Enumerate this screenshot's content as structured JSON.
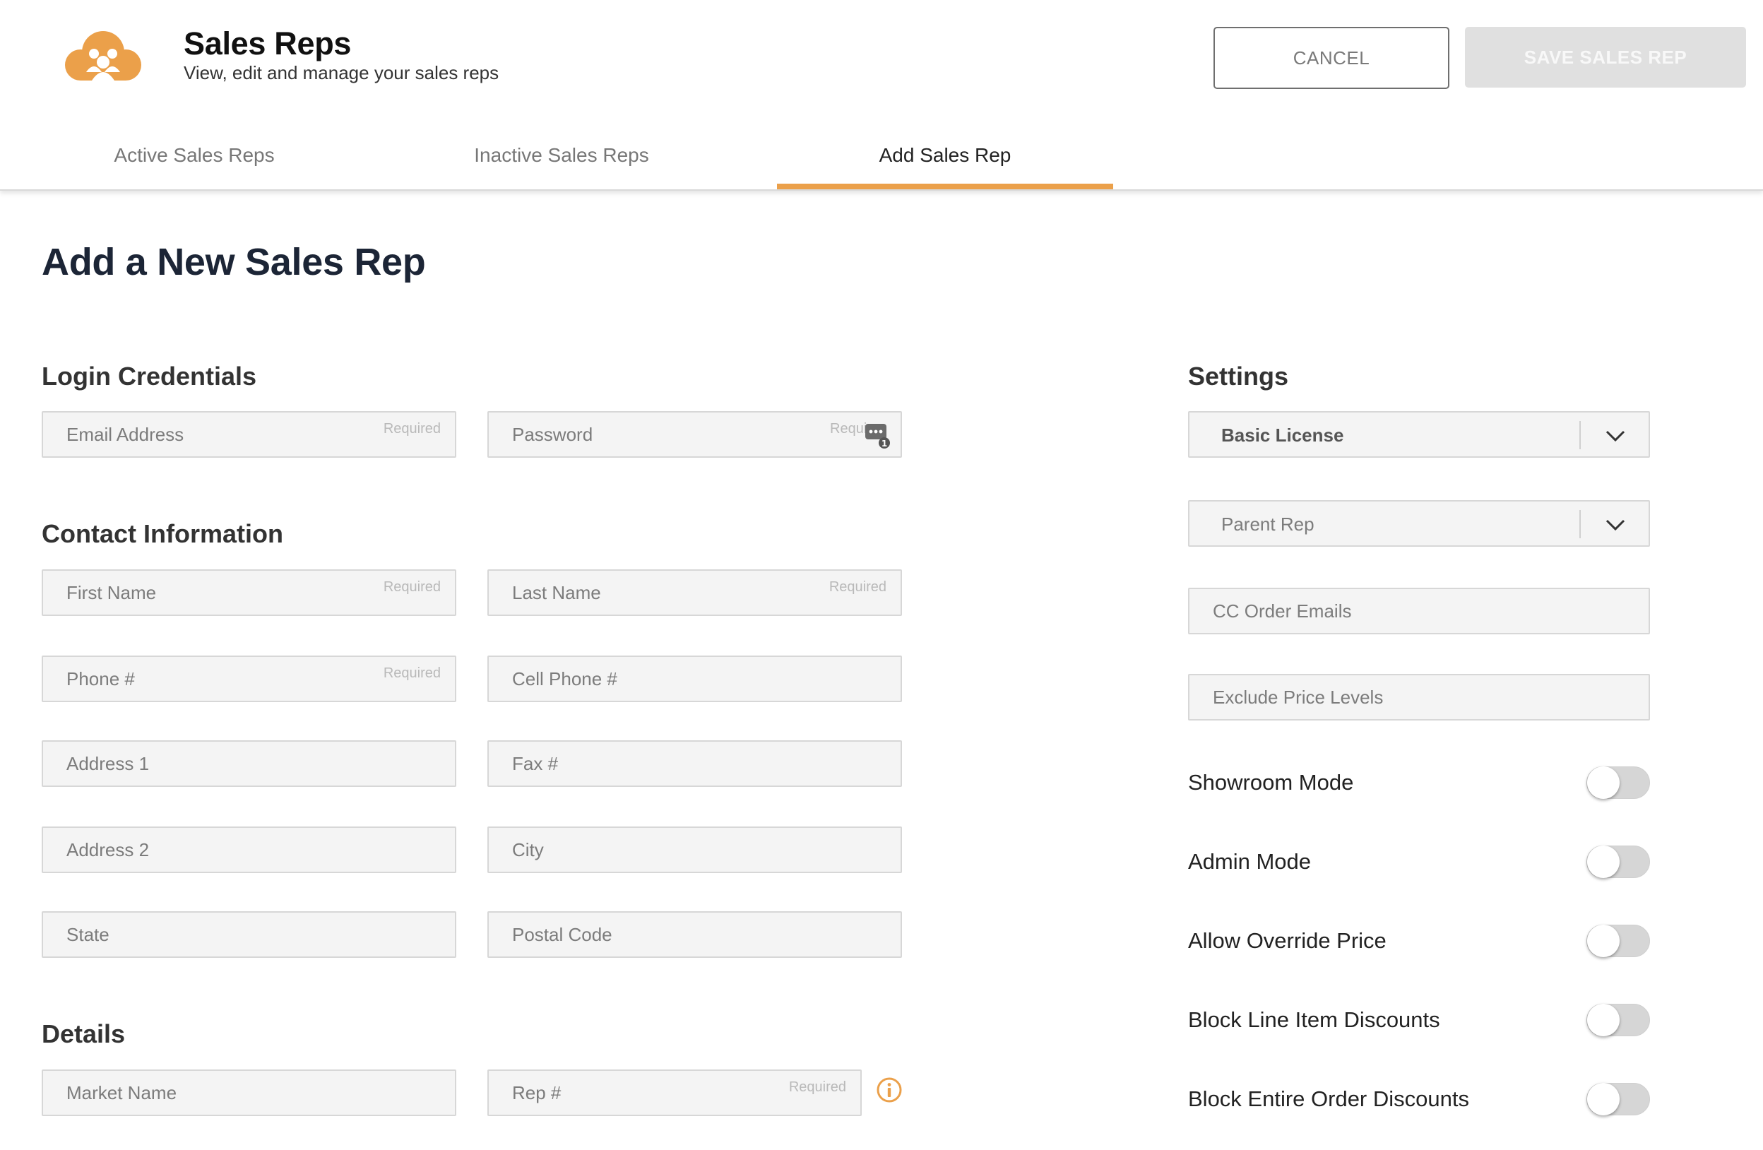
{
  "header": {
    "title": "Sales Reps",
    "subtitle": "View, edit and manage your sales reps",
    "cancel_label": "CANCEL",
    "save_label": "SAVE SALES REP",
    "logo_icon": "cloud-people-icon",
    "accent_color": "#eba04a"
  },
  "tabs": [
    {
      "label": "Active Sales Reps",
      "active": false
    },
    {
      "label": "Inactive Sales Reps",
      "active": false
    },
    {
      "label": "Add Sales Rep",
      "active": true
    }
  ],
  "page_title": "Add a New Sales Rep",
  "sections": {
    "login": "Login Credentials",
    "contact": "Contact Information",
    "details": "Details",
    "settings": "Settings"
  },
  "required_label": "Required",
  "fields": {
    "email": {
      "placeholder": "Email Address",
      "value": ""
    },
    "password": {
      "placeholder": "Password",
      "value": ""
    },
    "first_name": {
      "placeholder": "First Name",
      "value": ""
    },
    "last_name": {
      "placeholder": "Last Name",
      "value": ""
    },
    "phone": {
      "placeholder": "Phone #",
      "value": ""
    },
    "cell_phone": {
      "placeholder": "Cell Phone #",
      "value": ""
    },
    "address1": {
      "placeholder": "Address 1",
      "value": ""
    },
    "fax": {
      "placeholder": "Fax #",
      "value": ""
    },
    "address2": {
      "placeholder": "Address 2",
      "value": ""
    },
    "city": {
      "placeholder": "City",
      "value": ""
    },
    "state": {
      "placeholder": "State",
      "value": ""
    },
    "postal_code": {
      "placeholder": "Postal Code",
      "value": ""
    },
    "market_name": {
      "placeholder": "Market Name",
      "value": ""
    },
    "rep_number": {
      "placeholder": "Rep #",
      "value": ""
    },
    "cc_order_emails": {
      "placeholder": "CC Order Emails",
      "value": ""
    },
    "exclude_price_levels": {
      "placeholder": "Exclude Price Levels",
      "value": ""
    }
  },
  "selects": {
    "license": {
      "value": "Basic License"
    },
    "parent_rep": {
      "value": "Parent Rep"
    }
  },
  "toggles": [
    {
      "label": "Showroom Mode",
      "on": false
    },
    {
      "label": "Admin Mode",
      "on": false
    },
    {
      "label": "Allow Override Price",
      "on": false
    },
    {
      "label": "Block Line Item Discounts",
      "on": false
    },
    {
      "label": "Block Entire Order Discounts",
      "on": false
    }
  ]
}
